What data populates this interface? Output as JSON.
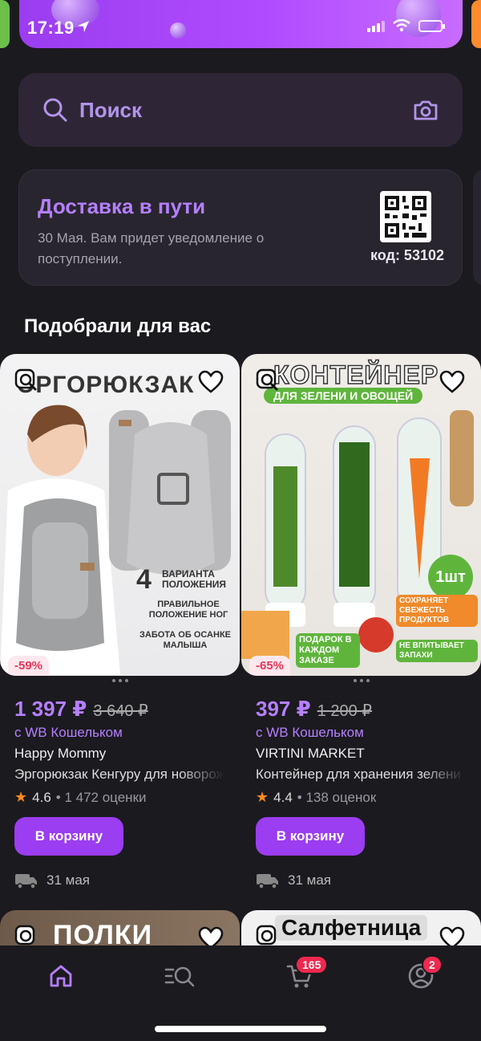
{
  "status_bar": {
    "time": "17:19"
  },
  "search": {
    "placeholder": "Поиск"
  },
  "delivery": {
    "title": "Доставка в пути",
    "text": "30 Мая. Вам придет уведомление о поступлении.",
    "code": "код: 53102"
  },
  "section_title": "Подобрали для вас",
  "products": [
    {
      "image_text": {
        "heading": "ЭРГОРЮКЗАК",
        "feature_num": "4",
        "feature_1": "ВАРИАНТА ПОЛОЖЕНИЯ",
        "feature_2": "ПРАВИЛЬНОЕ ПОЛОЖЕНИЕ НОГ",
        "feature_3": "ЗАБОТА ОБ ОСАНКЕ МАЛЫША"
      },
      "discount": "-59%",
      "price": "1 397 ₽",
      "old_price": "3 640 ₽",
      "wallet": "с WB Кошельком",
      "brand": "Happy Mommy",
      "name": "Эргорюкзак Кенгуру для новорожденных",
      "rating": "4.6",
      "reviews": "• 1 472 оценки",
      "cart_label": "В корзину",
      "delivery": "31 мая"
    },
    {
      "image_text": {
        "heading": "КОНТЕЙНЕР",
        "subheading": "ДЛЯ ЗЕЛЕНИ И ОВОЩЕЙ",
        "qty": "1шт",
        "gift": "ПОДАРОК В КАЖДОМ ЗАКАЗЕ",
        "feature_1": "СОХРАНЯЕТ СВЕЖЕСТЬ ПРОДУКТОВ",
        "feature_2": "НЕ ВПИТЫВАЕТ ЗАПАХИ"
      },
      "discount": "-65%",
      "price": "397 ₽",
      "old_price": "1 200 ₽",
      "wallet": "с WB Кошельком",
      "brand": "VIRTINI MARKET",
      "name": "Контейнер для хранения зелени",
      "rating": "4.4",
      "reviews": "• 138 оценок",
      "cart_label": "В корзину",
      "delivery": "31 мая"
    }
  ],
  "next_row": [
    "ПОЛКИ",
    "Салфетница"
  ],
  "tabbar": {
    "cart_badge": "165",
    "profile_badge": "2"
  },
  "colors": {
    "accent": "#9b3df0",
    "accent_text": "#b57fff",
    "badge": "#f0284e",
    "background": "#1b1a1f"
  }
}
